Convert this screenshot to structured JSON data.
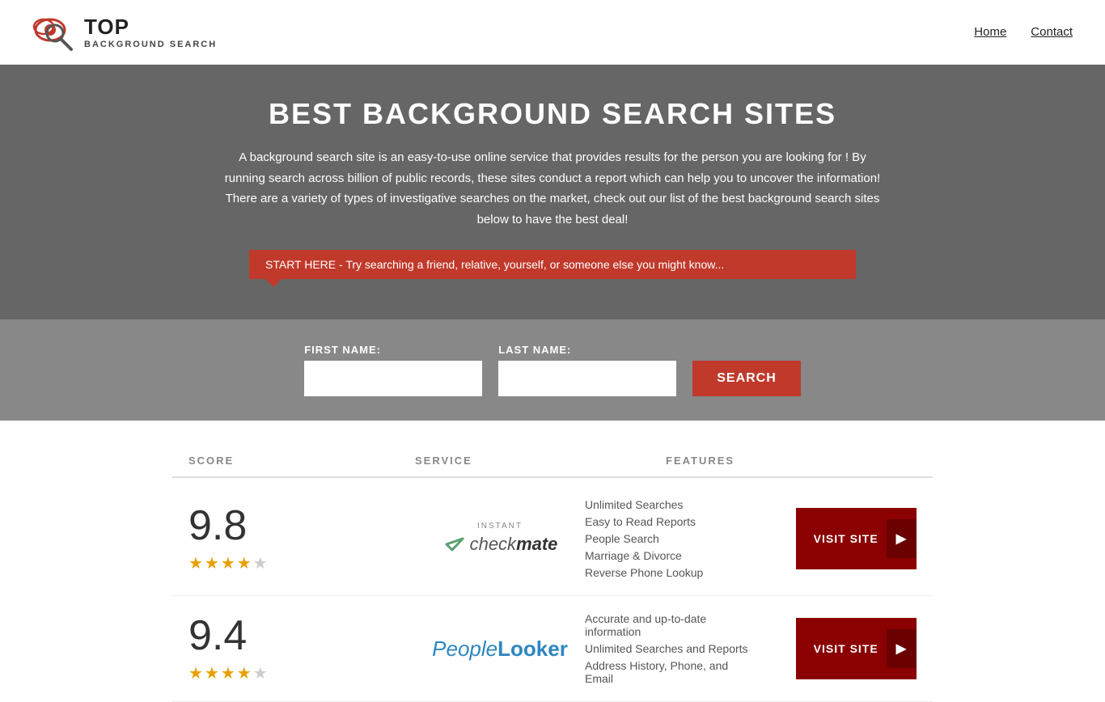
{
  "header": {
    "logo_top": "TOP",
    "logo_sub_line1": "BACKGROUND",
    "logo_sub_line2": "SEARCH",
    "nav": [
      {
        "label": "Home",
        "href": "#"
      },
      {
        "label": "Contact",
        "href": "#"
      }
    ]
  },
  "hero": {
    "title": "BEST BACKGROUND SEARCH SITES",
    "description": "A background search site is an easy-to-use online service that provides results  for the person you are looking for ! By  running  search across billion of public records, these sites conduct  a report which can help you to uncover the information! There are a variety of types of investigative searches on the market, check out our  list of the best background search sites below to have the best deal!",
    "callout": "START HERE - Try searching a friend, relative, yourself, or someone else you might know..."
  },
  "search": {
    "first_name_label": "FIRST NAME:",
    "last_name_label": "LAST NAME:",
    "button_label": "SEARCH",
    "first_name_placeholder": "",
    "last_name_placeholder": ""
  },
  "table": {
    "headers": {
      "score": "SCORE",
      "service": "SERVICE",
      "features": "FEATURES"
    },
    "rows": [
      {
        "score": "9.8",
        "stars": "★★★★★",
        "star_count": 5,
        "service_name": "Instant Checkmate",
        "service_logo_type": "checkmate",
        "features": [
          "Unlimited Searches",
          "Easy to Read Reports",
          "People Search",
          "Marriage & Divorce",
          "Reverse Phone Lookup"
        ],
        "visit_label": "VISIT SITE",
        "visit_href": "#"
      },
      {
        "score": "9.4",
        "stars": "★★★★★",
        "star_count": 5,
        "service_name": "PeopleLooker",
        "service_logo_type": "peoplelooker",
        "features": [
          "Accurate and up-to-date information",
          "Unlimited Searches and Reports",
          "Address History, Phone, and Email"
        ],
        "visit_label": "VISIT SITE",
        "visit_href": "#"
      }
    ]
  }
}
